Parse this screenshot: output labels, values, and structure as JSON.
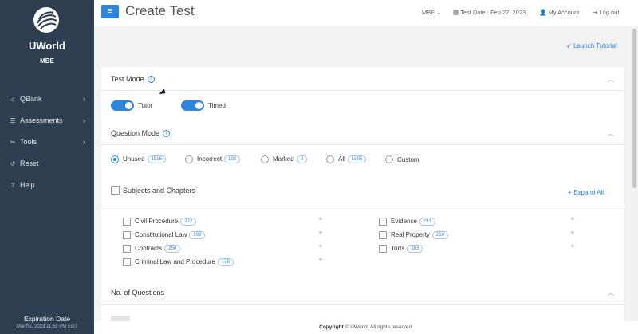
{
  "sidebar": {
    "brand": "UWorld",
    "subtitle": "MBE",
    "items": [
      {
        "label": "QBank",
        "icon": "bank-icon"
      },
      {
        "label": "Assessments",
        "icon": "list-icon"
      },
      {
        "label": "Tools",
        "icon": "tools-icon"
      },
      {
        "label": "Reset",
        "icon": "reset-icon"
      },
      {
        "label": "Help",
        "icon": "help-icon"
      }
    ],
    "expiration_title": "Expiration Date",
    "expiration_date": "Mar 01, 2023 11:59 PM EDT"
  },
  "header": {
    "title": "Create Test",
    "exam_select": "MBE",
    "test_date": "Test Date : Feb 22, 2023",
    "account": "My Account",
    "logout": "Log out"
  },
  "launch_tutorial": "Launch Tutorial",
  "test_mode": {
    "title": "Test Mode",
    "toggles": [
      {
        "label": "Tutor",
        "on": true
      },
      {
        "label": "Timed",
        "on": true
      }
    ]
  },
  "question_mode": {
    "title": "Question Mode",
    "options": [
      {
        "label": "Unused",
        "count": "1516",
        "selected": true
      },
      {
        "label": "Incorrect",
        "count": "102",
        "selected": false
      },
      {
        "label": "Marked",
        "count": "0",
        "selected": false
      },
      {
        "label": "All",
        "count": "1805",
        "selected": false
      },
      {
        "label": "Custom",
        "count": "",
        "selected": false
      }
    ]
  },
  "subjects": {
    "title": "Subjects and Chapters",
    "expand_all": "Expand All",
    "items": [
      {
        "label": "Civil Procedure",
        "count": "272"
      },
      {
        "label": "Constitutional Law",
        "count": "192"
      },
      {
        "label": "Contracts",
        "count": "250"
      },
      {
        "label": "Criminal Law and Procedure",
        "count": "178"
      },
      {
        "label": "Evidence",
        "count": "231"
      },
      {
        "label": "Real Property",
        "count": "210"
      },
      {
        "label": "Torts",
        "count": "183"
      }
    ]
  },
  "num_questions": {
    "title": "No. of Questions"
  },
  "footer": {
    "copyright_label": "Copyright",
    "copyright_text": "© UWorld. All rights reserved."
  },
  "colors": {
    "sidebar": "#2c3e50",
    "accent": "#2e86de"
  }
}
